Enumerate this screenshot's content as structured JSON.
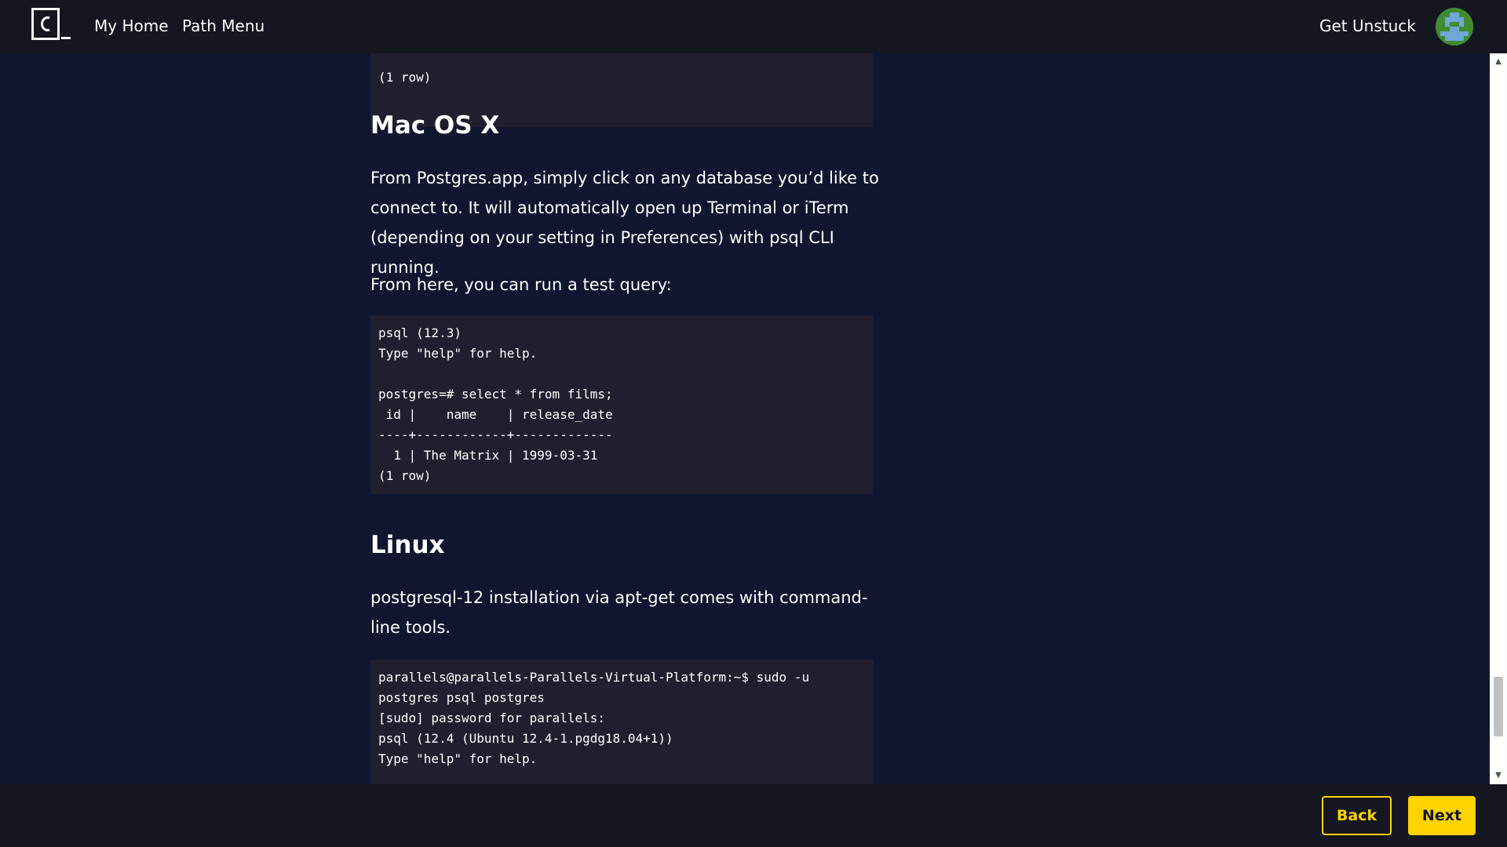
{
  "nav": {
    "home": "My Home",
    "path_menu": "Path Menu",
    "get_unstuck": "Get Unstuck"
  },
  "content": {
    "code_top_tail": "(1 row)",
    "mac_heading": "Mac OS X",
    "mac_paragraph_1": "From Postgres.app, simply click on any database you’d like to connect to. It will automatically open up Terminal or iTerm (depending on your setting in Preferences) with psql CLI running.",
    "mac_paragraph_2": "From here, you can run a test query:",
    "mac_code": "psql (12.3)\nType \"help\" for help.\n\npostgres=# select * from films;\n id |    name    | release_date\n----+------------+-------------\n  1 | The Matrix | 1999-03-31\n(1 row)",
    "linux_heading": "Linux",
    "linux_paragraph": "postgresql-12 installation via apt-get comes with command-line tools.",
    "linux_code": "parallels@parallels-Parallels-Virtual-Platform:~$ sudo -u\npostgres psql postgres\n[sudo] password for parallels:\npsql (12.4 (Ubuntu 12.4-1.pgdg18.04+1))\nType \"help\" for help."
  },
  "footer": {
    "back": "Back",
    "next": "Next"
  },
  "colors": {
    "accent": "#ffd300",
    "background": "#10162f",
    "code_background": "#211e2f",
    "bar_background": "#141620"
  },
  "icons": {
    "logo": "codecademy-logo-icon",
    "avatar": "pixel-avatar-icon"
  }
}
